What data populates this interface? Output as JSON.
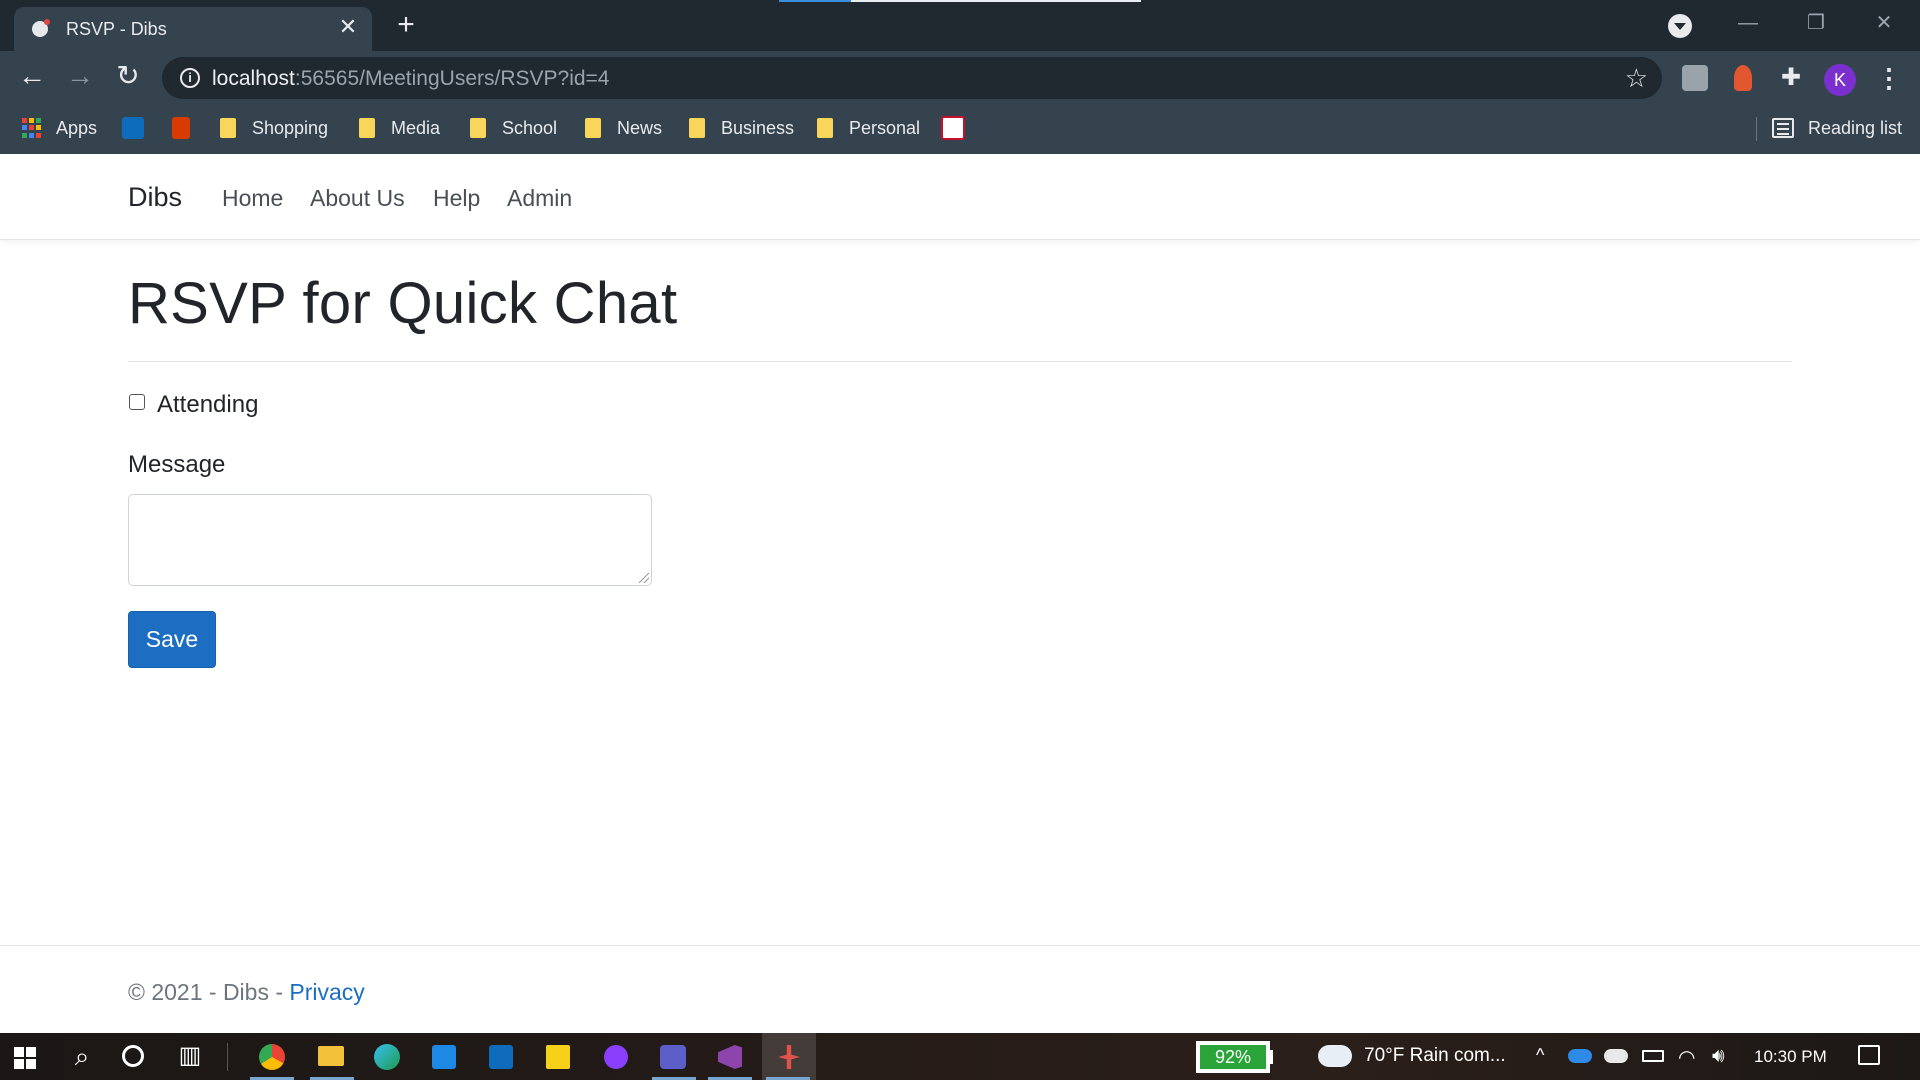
{
  "browser": {
    "tab_title": "RSVP - Dibs",
    "url_host": "localhost",
    "url_path": ":56565/MeetingUsers/RSVP?id=4",
    "avatar_letter": "K",
    "bookmarks": [
      {
        "label": "Apps",
        "icon": "apps-grid-icon"
      },
      {
        "label": "",
        "icon": "outlook-icon"
      },
      {
        "label": "",
        "icon": "office-icon"
      },
      {
        "label": "Shopping",
        "icon": "folder-icon"
      },
      {
        "label": "Media",
        "icon": "folder-icon"
      },
      {
        "label": "School",
        "icon": "folder-icon"
      },
      {
        "label": "News",
        "icon": "folder-icon"
      },
      {
        "label": "Business",
        "icon": "folder-icon"
      },
      {
        "label": "Personal",
        "icon": "folder-icon"
      },
      {
        "label": "",
        "icon": "university-icon"
      }
    ],
    "reading_list": "Reading list"
  },
  "navbar": {
    "brand": "Dibs",
    "links": [
      "Home",
      "About Us",
      "Help",
      "Admin"
    ]
  },
  "form": {
    "title": "RSVP for Quick Chat",
    "attending_label": "Attending",
    "attending_checked": false,
    "message_label": "Message",
    "message_value": "",
    "save_label": "Save"
  },
  "footer": {
    "copyright": "© 2021 - Dibs - ",
    "privacy": "Privacy"
  },
  "taskbar": {
    "battery": "92%",
    "weather": "70°F  Rain com...",
    "time": "10:30 PM",
    "apps": [
      "chrome-icon",
      "file-explorer-icon",
      "edge-icon",
      "calendar-icon",
      "outlook-icon",
      "sticky-notes-icon",
      "github-icon",
      "teams-icon",
      "visual-studio-icon",
      "debug-app-icon"
    ]
  },
  "colors": {
    "primary_button": "#1b6ec2",
    "link": "#1b6ec2",
    "chrome_frame": "#35434f",
    "battery": "#2aa339"
  }
}
